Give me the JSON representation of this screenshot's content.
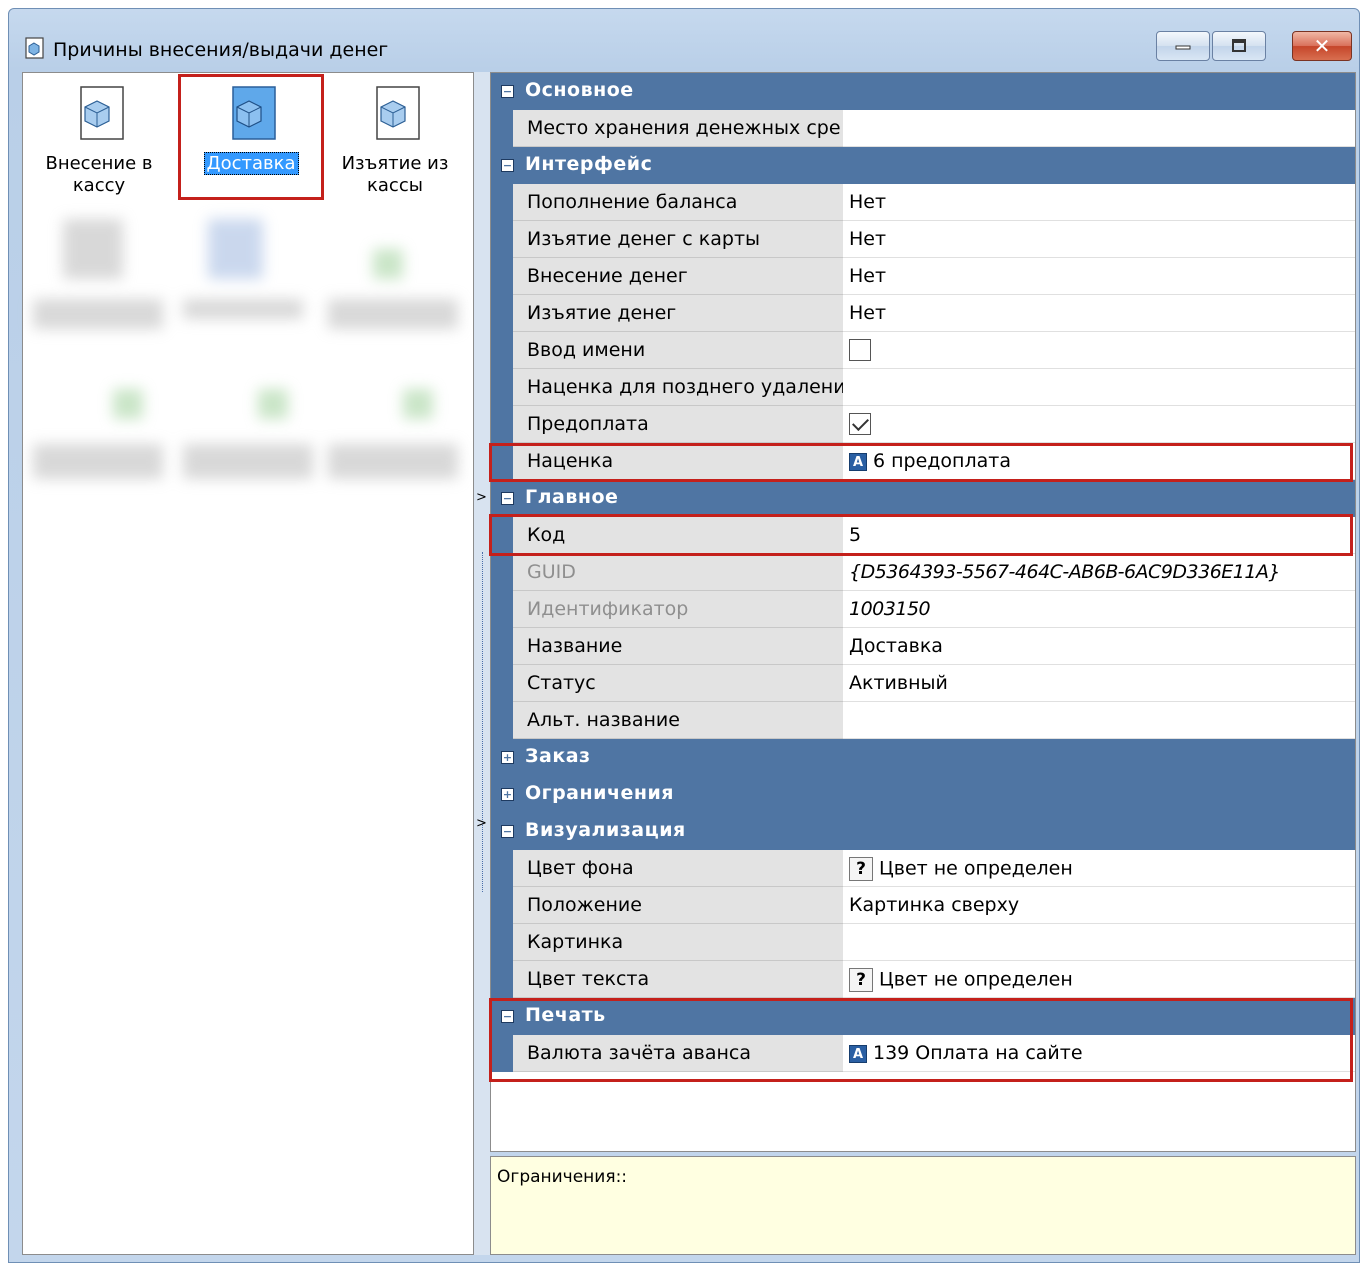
{
  "window": {
    "title": "Причины внесения/выдачи денег",
    "close_glyph": "✕"
  },
  "tiles": [
    {
      "label": "Внесение в кассу",
      "icon": "cube-icon",
      "selected": false
    },
    {
      "label": "Доставка",
      "icon": "cube-icon",
      "selected": true
    },
    {
      "label": "Изъятие из кассы",
      "icon": "cube-icon",
      "selected": false
    }
  ],
  "categories": {
    "osnovnoe": {
      "label": "Основное",
      "expanded": true
    },
    "interfeis": {
      "label": "Интерфейс",
      "expanded": true
    },
    "glavnoe": {
      "label": "Главное",
      "expanded": true
    },
    "zakaz": {
      "label": "Заказ",
      "expanded": false
    },
    "ogranicheniya": {
      "label": "Ограничения",
      "expanded": false
    },
    "vizualizatsiya": {
      "label": "Визуализация",
      "expanded": true
    },
    "pechat": {
      "label": "Печать",
      "expanded": true
    }
  },
  "props": {
    "mesto_hraneniya": {
      "name": "Место хранения денежных сре",
      "value": ""
    },
    "popolnenie": {
      "name": "Пополнение баланса",
      "value": "Нет"
    },
    "izyatie_karty": {
      "name": "Изъятие денег с карты",
      "value": "Нет"
    },
    "vnesenie": {
      "name": "Внесение денег",
      "value": "Нет"
    },
    "izyatie": {
      "name": "Изъятие денег",
      "value": "Нет"
    },
    "vvod_imeni": {
      "name": "Ввод имени",
      "checked": false
    },
    "natsenka_pozd": {
      "name": "Наценка для позднего удалени",
      "value": ""
    },
    "predoplata": {
      "name": "Предоплата",
      "checked": true
    },
    "natsenka": {
      "name": "Наценка",
      "badge": "A",
      "value": "6 предоплата"
    },
    "kod": {
      "name": "Код",
      "value": "5"
    },
    "guid": {
      "name": "GUID",
      "value": "{D5364393-5567-464C-AB6B-6AC9D336E11A}"
    },
    "identifikator": {
      "name": "Идентификатор",
      "value": "1003150"
    },
    "nazvanie": {
      "name": "Название",
      "value": "Доставка"
    },
    "status": {
      "name": "Статус",
      "value": "Активный"
    },
    "alt_nazvanie": {
      "name": "Альт. название",
      "value": ""
    },
    "tsvet_fona": {
      "name": "Цвет фона",
      "badge": "?",
      "value": "Цвет не определен"
    },
    "polozhenie": {
      "name": "Положение",
      "value": "Картинка сверху"
    },
    "kartinka": {
      "name": "Картинка",
      "value": ""
    },
    "tsvet_teksta": {
      "name": "Цвет текста",
      "badge": "?",
      "value": "Цвет не определен"
    },
    "valyuta": {
      "name": "Валюта зачёта аванса",
      "badge": "A",
      "value": "139 Оплата на сайте"
    }
  },
  "description": "Ограничения::",
  "colors": {
    "category_bg": "#4f75a3",
    "highlight": "#c4201b",
    "selection": "#3399ff",
    "description_bg": "#ffffe1"
  }
}
